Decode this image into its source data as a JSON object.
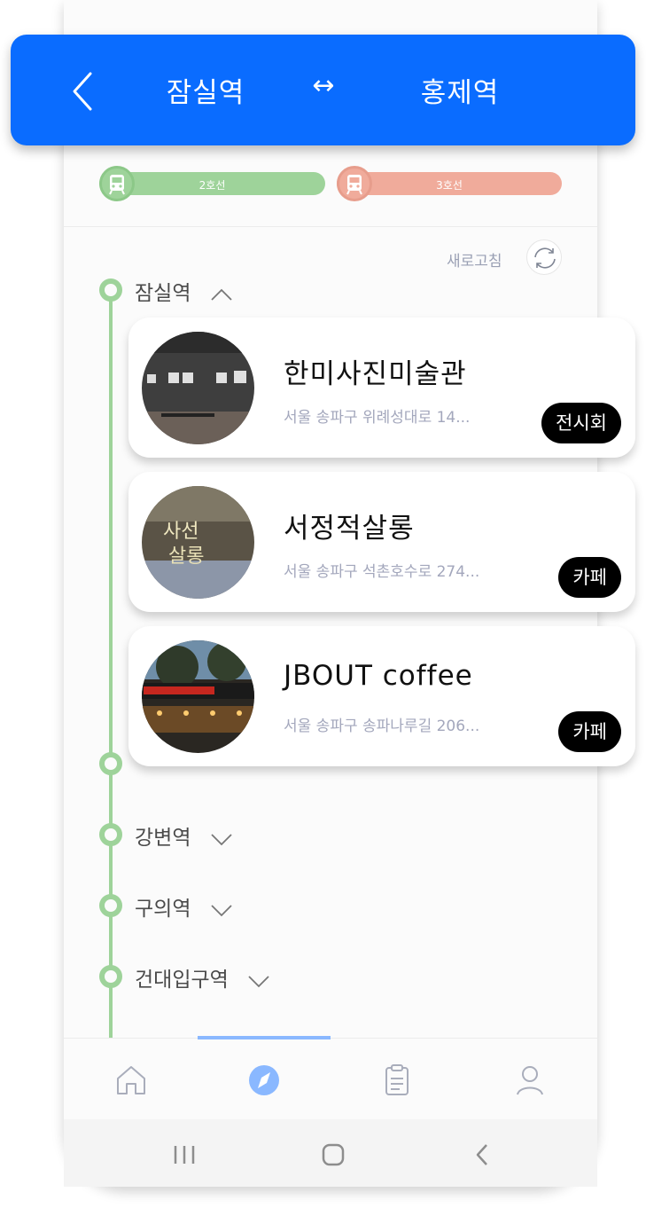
{
  "header": {
    "from_station": "잠실역",
    "swap_symbol": "↔",
    "to_station": "홍제역"
  },
  "lines": [
    {
      "label": "2호선",
      "color": "#9ed39a"
    },
    {
      "label": "3호선",
      "color": "#f0ab9b"
    }
  ],
  "refresh": {
    "label": "새로고침"
  },
  "stations": [
    {
      "name": "잠실역",
      "expanded": true
    },
    {
      "name": "강변역",
      "expanded": false
    },
    {
      "name": "구의역",
      "expanded": false
    },
    {
      "name": "건대입구역",
      "expanded": false
    }
  ],
  "places": [
    {
      "name": "한미사진미술관",
      "address": "서울 송파구 위례성대로 14...",
      "tag": "전시회"
    },
    {
      "name": "서정적살롱",
      "address": "서울 송파구 석촌호수로 274...",
      "tag": "카페"
    },
    {
      "name": "JBOUT coffee",
      "address": "서울 송파구 송파나루길 206...",
      "tag": "카페"
    }
  ],
  "tabs": [
    {
      "icon": "home-icon",
      "active": false
    },
    {
      "icon": "compass-icon",
      "active": true
    },
    {
      "icon": "clipboard-icon",
      "active": false
    },
    {
      "icon": "user-icon",
      "active": false
    }
  ],
  "colors": {
    "primary": "#0a6cff",
    "line2": "#9ed39a",
    "line3": "#f0ab9b",
    "tab_active": "#8ab8ff"
  }
}
